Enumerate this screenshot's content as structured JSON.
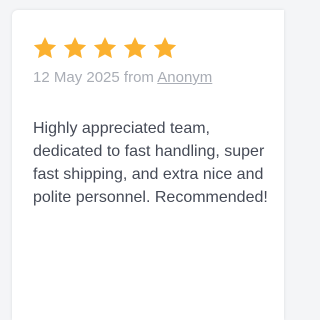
{
  "review": {
    "rating": 5,
    "rating_max": 5,
    "star_color": "#fbb12f",
    "star_icon": "star-icon",
    "date": "12 May 2025",
    "from_text": "from",
    "author": "Anonym",
    "text": "Highly appreciated team, dedicated to fast handling, super fast shipping, and extra nice and polite personnel. Recommended!"
  }
}
